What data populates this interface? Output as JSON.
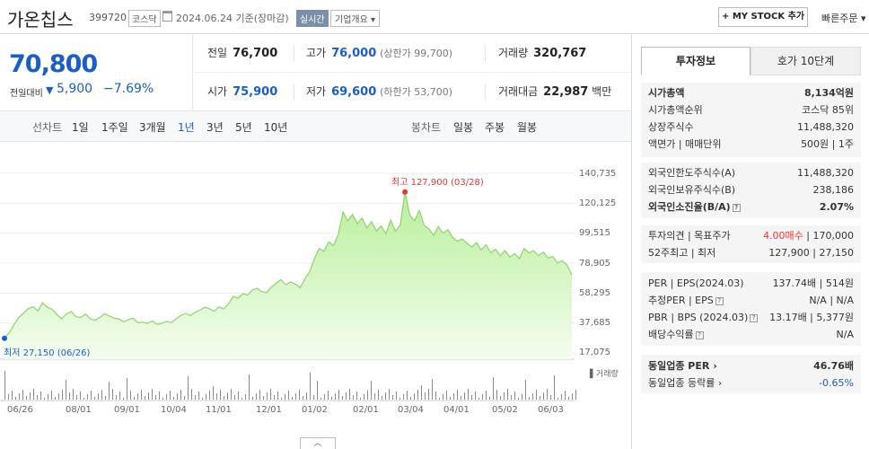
{
  "header": {
    "stock_name": "가온칩스",
    "stock_code": "399720",
    "market": "코스닥",
    "date": "2024.06.24 기준(장마감)",
    "realtime": "실시간",
    "corp_overview": "기업개요 ▾",
    "mystock_label": "+ MY STOCK 추가",
    "quick_order": "빠른주문 ▾"
  },
  "price": {
    "current": "70,800",
    "change_label": "전일대비",
    "change_arrow": "▼",
    "change": "5,900",
    "change_pct": "−7.69%"
  },
  "summary": {
    "prev_close_label": "전일",
    "prev_close": "76,700",
    "high_label": "고가",
    "high": "76,000",
    "upper_limit": "(상한가 99,700)",
    "volume_label": "거래량",
    "volume": "320,767",
    "open_label": "시가",
    "open": "75,900",
    "low_label": "저가",
    "low": "69,600",
    "lower_limit": "(하한가 53,700)",
    "value_label": "거래대금",
    "value": "22,987",
    "value_unit": "백만"
  },
  "range_tabs": {
    "line_label": "선차트",
    "ranges": [
      "1일",
      "1주일",
      "3개월",
      "1년",
      "3년",
      "5년",
      "10년"
    ],
    "active": "1년",
    "candle_label": "봉차트",
    "candles": [
      "일봉",
      "주봉",
      "월봉"
    ]
  },
  "chart_data": {
    "type": "area",
    "title": "",
    "y_ticks": [
      "140,735",
      "120,125",
      "99,515",
      "78,905",
      "58,295",
      "37,685",
      "17,075"
    ],
    "ylim": [
      17075,
      140735
    ],
    "x_ticks": [
      "06/26",
      "08/01",
      "09/01",
      "10/04",
      "11/01",
      "12/01",
      "01/02",
      "02/01",
      "03/04",
      "04/01",
      "05/02",
      "06/03"
    ],
    "high_label": "최고 127,900 (03/28)",
    "low_label": "최저 27,150 (06/26)",
    "volume_label": "거래량",
    "values": [
      27150,
      31000,
      36500,
      41500,
      44500,
      47500,
      49000,
      46000,
      51500,
      48500,
      47000,
      43500,
      40500,
      44000,
      45500,
      42000,
      41500,
      43800,
      40500,
      39500,
      41500,
      44000,
      42500,
      41000,
      40500,
      38500,
      40000,
      41000,
      37800,
      38200,
      37500,
      39000,
      36800,
      37400,
      38800,
      38000,
      40500,
      43000,
      44200,
      42800,
      45000,
      46500,
      48500,
      47500,
      45800,
      48800,
      47400,
      51000,
      56000,
      54800,
      57800,
      56900,
      60500,
      61500,
      59200,
      58700,
      62500,
      65000,
      67500,
      64000,
      66000,
      64500,
      62000,
      68000,
      73000,
      82000,
      89000,
      87000,
      93500,
      91000,
      98500,
      114000,
      108000,
      112500,
      106000,
      110000,
      103000,
      107500,
      101000,
      104500,
      99000,
      108500,
      101000,
      105000,
      127900,
      112000,
      108000,
      115000,
      105000,
      102500,
      98000,
      104000,
      99500,
      102000,
      96500,
      94000,
      95500,
      92500,
      90000,
      93000,
      88000,
      91500,
      86000,
      88500,
      84000,
      87500,
      83000,
      85500,
      82000,
      89000,
      86000,
      87500,
      84000,
      86500,
      82500,
      83500,
      79000,
      80500,
      77500,
      70800
    ]
  },
  "right_panel": {
    "tab_invest": "투자정보",
    "tab_hoga": "호가 10단계",
    "market_cap_label": "시가총액",
    "market_cap": "8,134억원",
    "cap_rank_label": "시가총액순위",
    "cap_rank": "코스닥 85위",
    "shares_label": "상장주식수",
    "shares": "11,488,320",
    "par_label": "액면가 | 매매단위",
    "par": "500원 | 1주",
    "foreign_limit_label": "외국인한도주식수(A)",
    "foreign_limit": "11,488,320",
    "foreign_hold_label": "외국인보유주식수(B)",
    "foreign_hold": "238,186",
    "foreign_ratio_label": "외국인소진율(B/A)",
    "foreign_ratio": "2.07%",
    "opinion_label": "투자의견 | 목표주가",
    "opinion": "4.00매수",
    "target": "170,000",
    "w52_label": "52주최고 | 최저",
    "w52": "127,900 | 27,150",
    "per_label": "PER | EPS(2024.03)",
    "per": "137.74배 | 514원",
    "est_per_label": "추정PER | EPS",
    "est_per": "N/A | N/A",
    "pbr_label": "PBR | BPS (2024.03)",
    "pbr": "13.17배 | 5,377원",
    "div_label": "배당수익률",
    "div": "N/A",
    "sector_per_label": "동일업종 PER",
    "sector_per": "46.76배",
    "sector_rate_label": "동일업종 등락률",
    "sector_rate": "-0.65%"
  },
  "bottom_toggle": "︿"
}
